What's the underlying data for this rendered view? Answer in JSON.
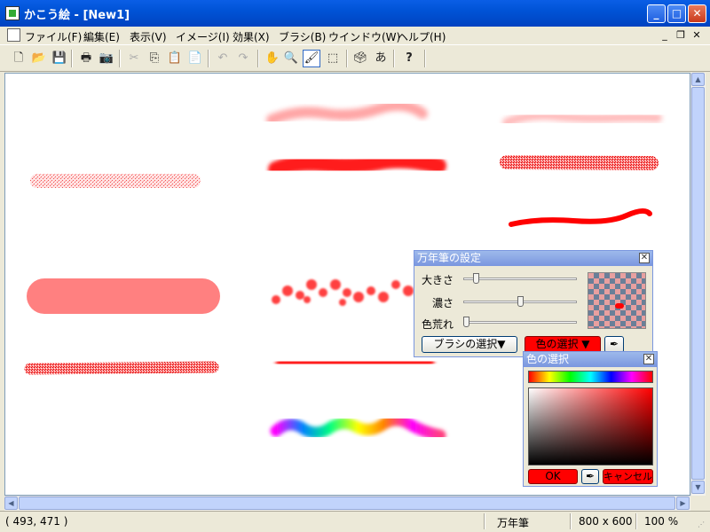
{
  "window": {
    "title": "かこう絵 - [New1]",
    "buttons": {
      "minimize": "_",
      "maximize": "□",
      "close": "✕"
    }
  },
  "menu": {
    "items": [
      "ファイル(F)",
      "編集(E)",
      "表示(V)",
      "イメージ(I)",
      "効果(X)",
      "ブラシ(B)",
      "ウインドウ(W)",
      "ヘルプ(H)"
    ],
    "mdi_buttons": [
      "_",
      "❐",
      "✕"
    ]
  },
  "toolbar": {
    "tools": [
      {
        "name": "new-icon",
        "glyph": "🗋",
        "enabled": true
      },
      {
        "name": "open-icon",
        "glyph": "📂",
        "enabled": true
      },
      {
        "name": "save-icon",
        "glyph": "💾",
        "enabled": true
      },
      {
        "name": "print-icon",
        "glyph": "🖶",
        "enabled": true
      },
      {
        "name": "camera-icon",
        "glyph": "📷",
        "enabled": true
      },
      {
        "name": "cut-icon",
        "glyph": "✂",
        "enabled": false
      },
      {
        "name": "copy-icon",
        "glyph": "⎘",
        "enabled": true
      },
      {
        "name": "paste-icon",
        "glyph": "📋",
        "enabled": true
      },
      {
        "name": "paste-new-icon",
        "glyph": "📄",
        "enabled": true
      },
      {
        "name": "undo-icon",
        "glyph": "↶",
        "enabled": false
      },
      {
        "name": "redo-icon",
        "glyph": "↷",
        "enabled": false
      },
      {
        "name": "hand-icon",
        "glyph": "✋",
        "enabled": true
      },
      {
        "name": "zoom-icon",
        "glyph": "🔍",
        "enabled": true
      },
      {
        "name": "brush-icon",
        "glyph": "🖌",
        "enabled": true,
        "active": true
      },
      {
        "name": "select-rect-icon",
        "glyph": "⬚",
        "enabled": true
      },
      {
        "name": "stamp-icon",
        "glyph": "🗳",
        "enabled": true
      },
      {
        "name": "text-icon",
        "glyph": "あ",
        "enabled": true
      },
      {
        "name": "help-icon",
        "glyph": "?",
        "enabled": true
      }
    ]
  },
  "brush_settings": {
    "title": "万年筆の設定",
    "close": "✕",
    "sliders": [
      {
        "label": "大きさ",
        "value": 0.1
      },
      {
        "label": "濃さ",
        "value": 0.5
      },
      {
        "label": "色荒れ",
        "value": 0.0
      }
    ],
    "brush_select_label": "ブラシの選択▼",
    "color_select_label": "色の選択 ▼",
    "current_color": "#ff0000"
  },
  "color_picker": {
    "title": "色の選択",
    "close": "✕",
    "ok_label": "OK",
    "cancel_label": "キャンセル",
    "color": "#ff0000"
  },
  "statusbar": {
    "coords": "( 493, 471 )",
    "tool": "万年筆",
    "size": "800 x 600",
    "zoom": "100 %"
  },
  "colors": {
    "stroke_red": "#ff0000",
    "light_red": "#ff8080",
    "accent": "#316ac5"
  }
}
